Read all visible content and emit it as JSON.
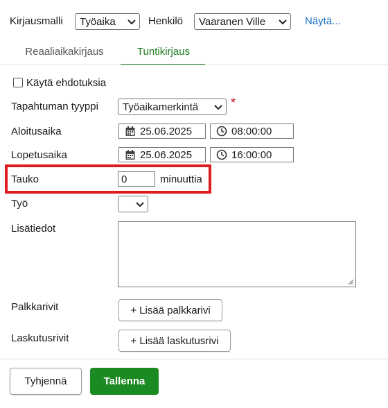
{
  "toolbar": {
    "template_label": "Kirjausmalli",
    "template_value": "Työaika",
    "person_label": "Henkilö",
    "person_value": "Vaaranen Ville",
    "show_link": "Näytä..."
  },
  "tabs": [
    {
      "label": "Reaaliaikakirjaus",
      "active": false
    },
    {
      "label": "Tuntikirjaus",
      "active": true
    }
  ],
  "form": {
    "use_suggestions_label": "Käytä ehdotuksia",
    "use_suggestions_checked": false,
    "event_type_label": "Tapahtuman tyyppi",
    "event_type_value": "Työaikamerkintä",
    "required_marker": "*",
    "start_label": "Aloitusaika",
    "start_date": "25.06.2025",
    "start_time": "08:00:00",
    "end_label": "Lopetusaika",
    "end_date": "25.06.2025",
    "end_time": "16:00:00",
    "break_label": "Tauko",
    "break_value": "0",
    "break_unit": "minuuttia",
    "work_label": "Työ",
    "work_value": "",
    "notes_label": "Lisätiedot",
    "notes_value": "",
    "pay_rows_label": "Palkkarivit",
    "add_pay_row_button": "+ Lisää palkkarivi",
    "billing_rows_label": "Laskutusrivit",
    "add_billing_row_button": "+ Lisää laskutusrivi"
  },
  "footer": {
    "clear_button": "Tyhjennä",
    "save_button": "Tallenna"
  },
  "colors": {
    "accent_green": "#1c8a22",
    "link_blue": "#1a6fc4",
    "highlight_red": "#e01b1b",
    "required_red": "#c8102e"
  },
  "icons": [
    "chevron-down-icon",
    "calendar-icon",
    "clock-icon",
    "resize-grip-icon"
  ]
}
